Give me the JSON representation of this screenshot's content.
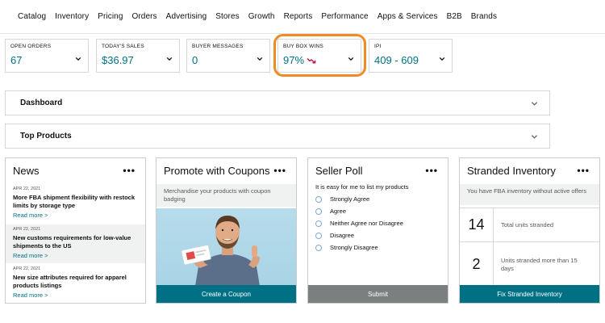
{
  "nav": [
    "Catalog",
    "Inventory",
    "Pricing",
    "Orders",
    "Advertising",
    "Stores",
    "Growth",
    "Reports",
    "Performance",
    "Apps & Services",
    "B2B",
    "Brands"
  ],
  "metrics": [
    {
      "label": "OPEN ORDERS",
      "value": "67"
    },
    {
      "label": "TODAY'S SALES",
      "value": "$36.97"
    },
    {
      "label": "BUYER MESSAGES",
      "value": "0"
    },
    {
      "label": "BUY BOX WINS",
      "value": "97%",
      "trend": "down"
    },
    {
      "label": "IPI",
      "value": "409 - 609"
    }
  ],
  "sections": [
    "Dashboard",
    "Top Products"
  ],
  "news": {
    "title": "News",
    "items": [
      {
        "date": "APR 22, 2021",
        "headline": "More FBA shipment flexibility with restock limits by storage type",
        "more": "Read more >"
      },
      {
        "date": "APR 22, 2021",
        "headline": "New customs requirements for low-value shipments to the US",
        "more": "Read more >"
      },
      {
        "date": "APR 22, 2021",
        "headline": "New size attributes required for apparel products listings",
        "more": "Read more >"
      }
    ]
  },
  "coupons": {
    "title": "Promote with Coupons",
    "description": "Merchandise your products with coupon badging",
    "button": "Create a Coupon"
  },
  "poll": {
    "title": "Seller Poll",
    "question": "It is easy for me to list my products",
    "options": [
      "Strongly Agree",
      "Agree",
      "Neither Agree nor Disagree",
      "Disagree",
      "Strongly Disagree"
    ],
    "button": "Submit"
  },
  "stranded": {
    "title": "Stranded Inventory",
    "description": "You have FBA inventory without active offers",
    "rows": [
      {
        "value": "14",
        "label": "Total units stranded"
      },
      {
        "value": "2",
        "label": "Units stranded more than 15 days"
      }
    ],
    "button": "Fix Stranded Inventory"
  },
  "menu_glyph": "•••",
  "colors": {
    "link": "#007185",
    "highlight": "#f08a24",
    "trend_down": "#cc0c39"
  }
}
